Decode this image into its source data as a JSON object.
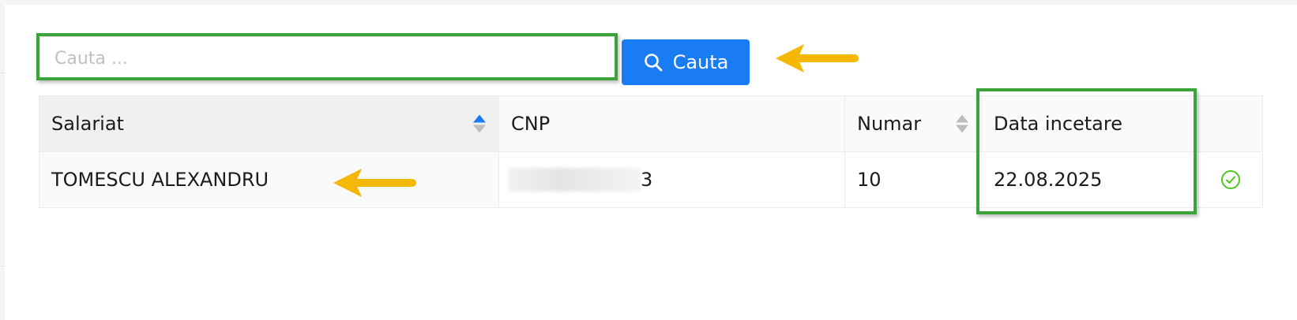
{
  "search": {
    "placeholder": "Cauta ...",
    "value": "",
    "button_label": "Cauta"
  },
  "table": {
    "columns": [
      {
        "label": "Salariat",
        "sortable": true,
        "sort_active": true
      },
      {
        "label": "CNP",
        "sortable": false
      },
      {
        "label": "Numar",
        "sortable": true,
        "sort_active": false
      },
      {
        "label": "Data incetare",
        "sortable": false
      },
      {
        "label": "",
        "sortable": false
      }
    ],
    "rows": [
      {
        "salariat": "TOMESCU ALEXANDRU",
        "cnp_visible_suffix": "3",
        "numar": "10",
        "data_incetare": "22.08.2025",
        "status_icon": "check-circle-icon"
      }
    ]
  },
  "colors": {
    "accent": "#1a7cf5",
    "highlight_box": "#3aa33a",
    "arrow": "#f5b800",
    "status_ok": "#52c41a"
  }
}
